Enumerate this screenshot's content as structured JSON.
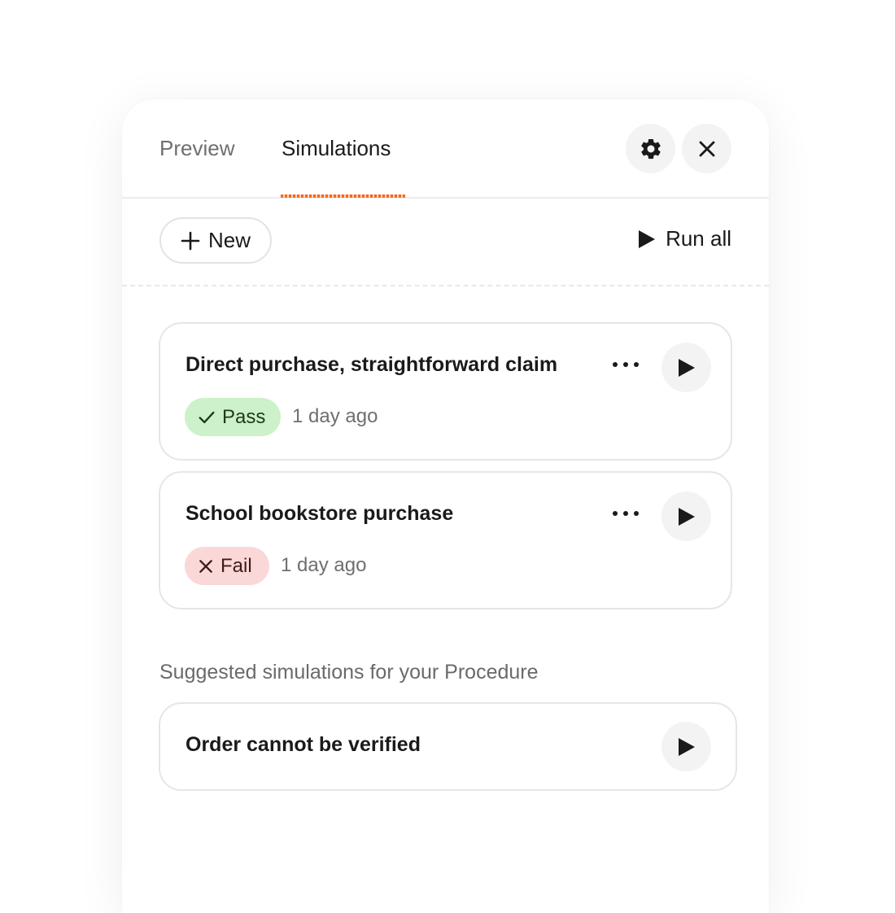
{
  "tabs": [
    {
      "label": "Preview",
      "active": false
    },
    {
      "label": "Simulations",
      "active": true
    }
  ],
  "accent_color": "#f26a21",
  "header_icons": [
    "gear-icon",
    "close-icon"
  ],
  "toolbar": {
    "new_label": "New",
    "run_all_label": "Run all"
  },
  "simulations": [
    {
      "title": "Direct purchase, straightforward claim",
      "status": "Pass",
      "status_color": "#cdf1c8",
      "time": "1 day ago"
    },
    {
      "title": "School bookstore purchase",
      "status": "Fail",
      "status_color": "#fbd8d8",
      "time": "1 day ago"
    }
  ],
  "suggested": {
    "label": "Suggested simulations for your Procedure",
    "items": [
      {
        "title": "Order cannot be verified"
      }
    ]
  }
}
